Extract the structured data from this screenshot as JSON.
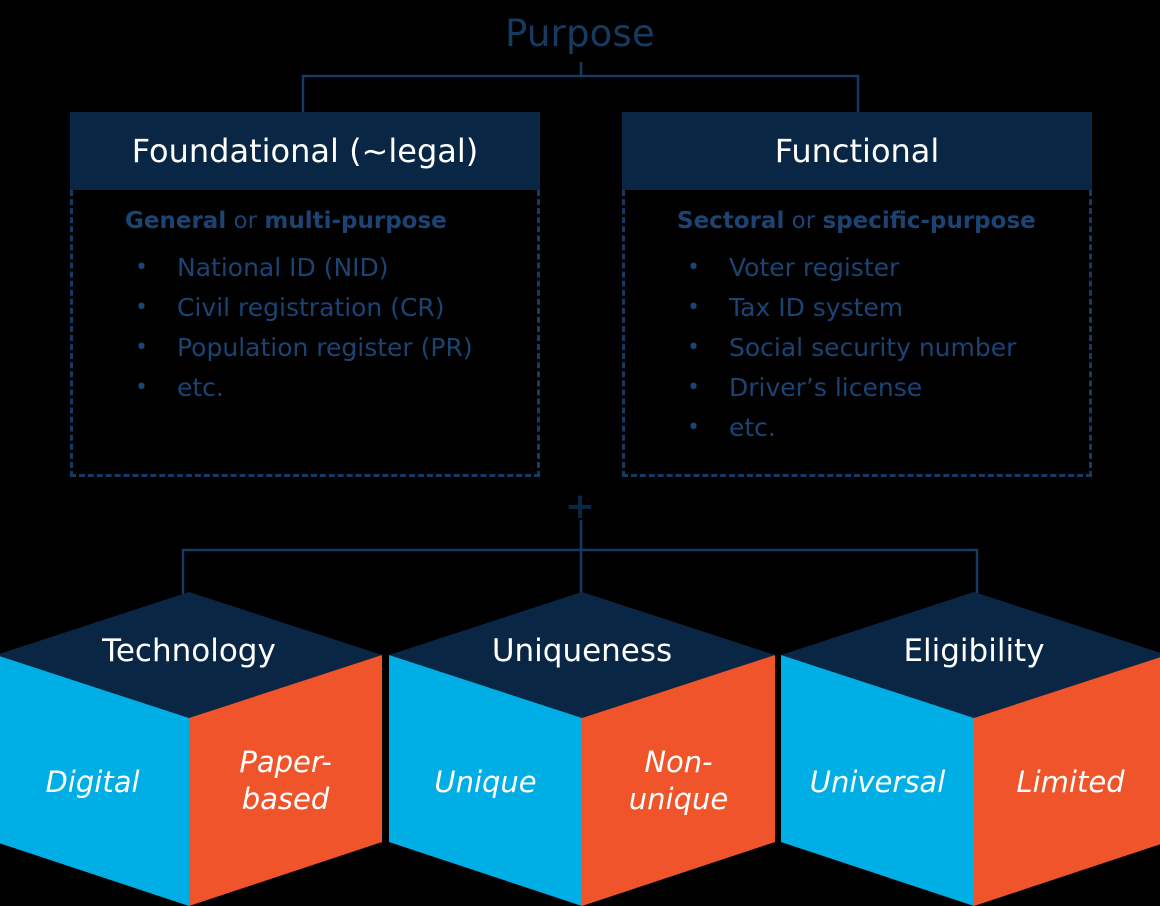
{
  "title": "Purpose",
  "plus": "+",
  "colors": {
    "background": "#000000",
    "navy": "#0A2645",
    "text_blue": "#1B4474",
    "border_blue": "#153A63",
    "cyan": "#00AEE6",
    "orange": "#F0542A",
    "white": "#FFFFFF"
  },
  "purpose_boxes": [
    {
      "header": "Foundational (~legal)",
      "subtitle_parts": [
        "General",
        " or ",
        "multi-purpose"
      ],
      "subtitle": "General or multi-purpose",
      "items": [
        "National ID (NID)",
        "Civil registration (CR)",
        "Population register (PR)",
        "etc."
      ]
    },
    {
      "header": "Functional",
      "subtitle_parts": [
        "Sectoral",
        " or ",
        "specific-purpose"
      ],
      "subtitle": "Sectoral or specific-purpose",
      "items": [
        "Voter register",
        "Tax ID system",
        "Social security number",
        "Driver’s license",
        "etc."
      ]
    }
  ],
  "cubes": [
    {
      "top": "Technology",
      "left": "Digital",
      "right": "Paper-based",
      "right_line1": "Paper-",
      "right_line2": "based"
    },
    {
      "top": "Uniqueness",
      "left": "Unique",
      "right": "Non-unique",
      "right_line1": "Non-",
      "right_line2": "unique"
    },
    {
      "top": "Eligibility",
      "left": "Universal",
      "right": "Limited",
      "right_line1": "Limited",
      "right_line2": ""
    }
  ]
}
